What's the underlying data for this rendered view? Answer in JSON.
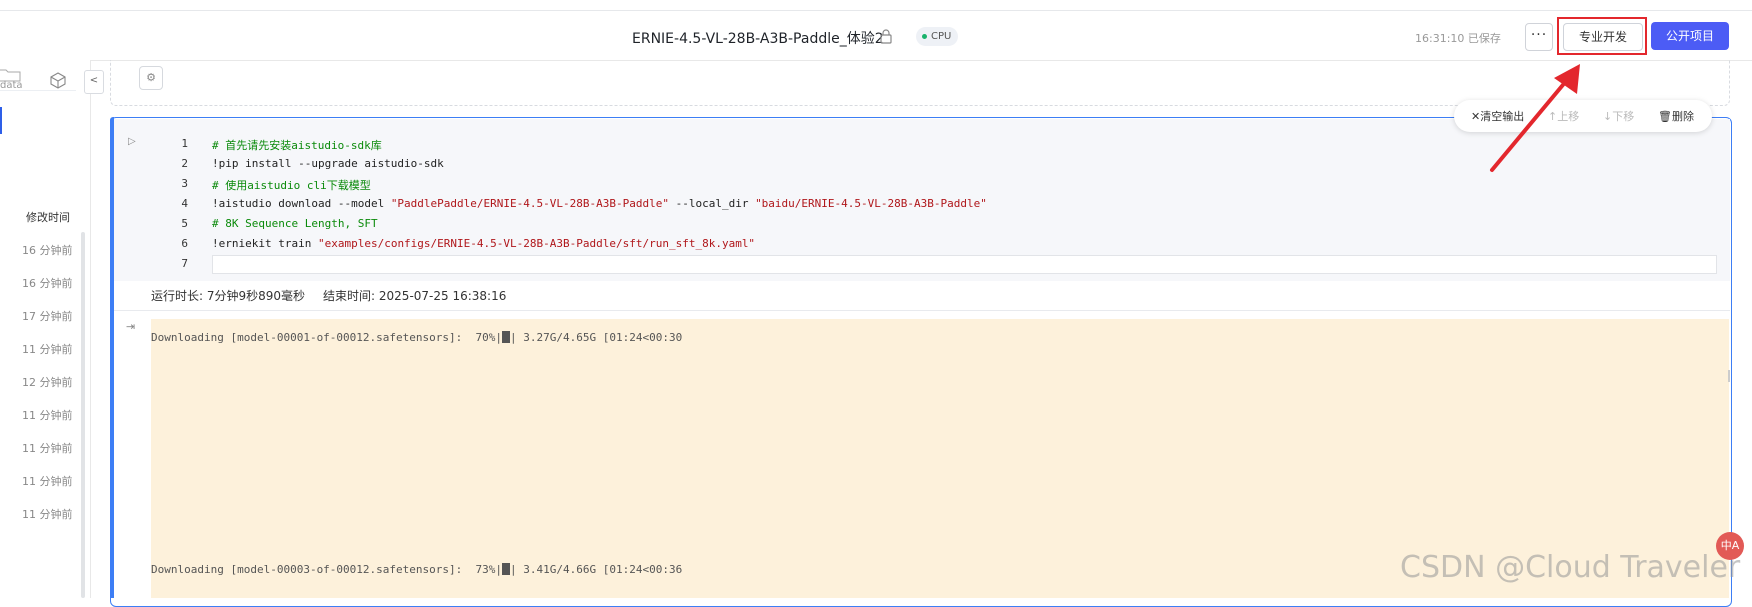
{
  "header": {
    "title": "ERNIE-4.5-VL-28B-A3B-Paddle_体验2",
    "status_tag": "CPU",
    "saved_text": "16:31:10 已保存",
    "more_label": "···",
    "pro_dev_label": "专业开发",
    "publish_label": "公开项目"
  },
  "sidebar": {
    "data_label": "data",
    "collapse_label": "<",
    "modified_header": "修改时间",
    "times": [
      "16 分钟前",
      "16 分钟前",
      "17 分钟前",
      "11 分钟前",
      "12 分钟前",
      "11 分钟前",
      "11 分钟前",
      "11 分钟前",
      "11 分钟前"
    ]
  },
  "cell": {
    "line_numbers": [
      "1",
      "2",
      "3",
      "4",
      "5",
      "6",
      "7"
    ],
    "code": {
      "l1": "# 首先请先安装aistudio-sdk库",
      "l2": "!pip install --upgrade aistudio-sdk",
      "l3": "# 使用aistudio cli下载模型",
      "l4_cmd": "!aistudio download --model ",
      "l4_model": "\"PaddlePaddle/ERNIE-4.5-VL-28B-A3B-Paddle\"",
      "l4_flag": " --local_dir ",
      "l4_dir": "\"baidu/ERNIE-4.5-VL-28B-A3B-Paddle\"",
      "l5": "# 8K Sequence Length, SFT",
      "l6_cmd": "!erniekit train ",
      "l6_path": "\"examples/configs/ERNIE-4.5-VL-28B-A3B-Paddle/sft/run_sft_8k.yaml\""
    },
    "exec": {
      "duration": "运行时长: 7分钟9秒890毫秒",
      "end_time": "结束时间: 2025-07-25 16:38:16"
    },
    "output": {
      "line1_pre": "Downloading [model-00001-of-00012.safetensors]:  70%|",
      "line1_post": "| 3.27G/4.65G [01:24<00:30",
      "line1_progress": 0.7,
      "line2_pre": "Downloading [model-00003-of-00012.safetensors]:  73%|",
      "line2_post": "| 3.41G/4.66G [01:24<00:36",
      "line2_progress": 0.73
    }
  },
  "toolbar": {
    "clear": "清空输出",
    "up": "上移",
    "down": "下移",
    "delete": "删除"
  },
  "watermark": "CSDN @Cloud Traveler",
  "float_button": "中A",
  "colors": {
    "accent": "#4c5cf5",
    "highlight": "#e3272d",
    "cell_border": "#3d7ef5",
    "output_bg": "#fdf1db"
  }
}
